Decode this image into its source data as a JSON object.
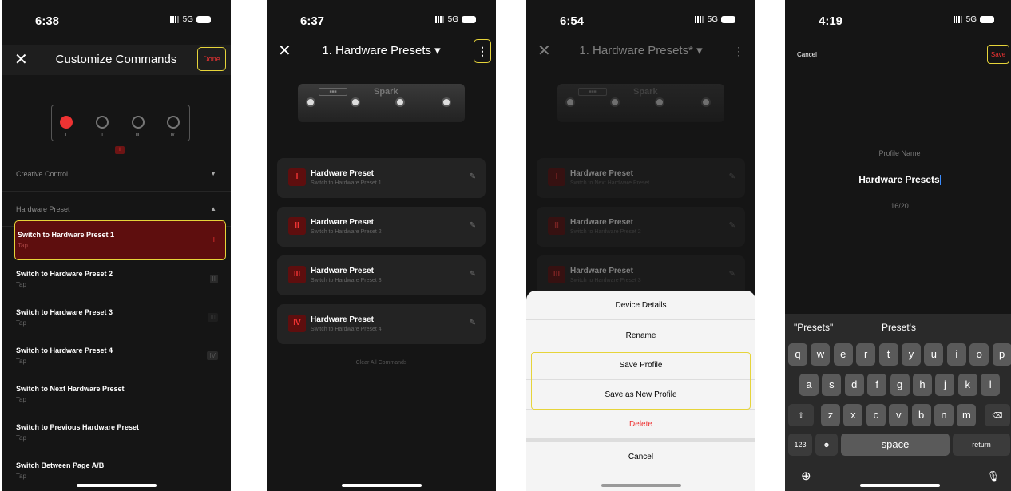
{
  "p1": {
    "time": "6:38",
    "net": "5G",
    "title": "Customize Commands",
    "done": "Done",
    "pedal_labels": [
      "I",
      "II",
      "III",
      "IV"
    ],
    "selected_badge": "I",
    "section_creative": "Creative Control",
    "section_hardware": "Hardware Preset",
    "rows": [
      {
        "title": "Switch to Hardware Preset 1",
        "sub": "Tap",
        "num": "I"
      },
      {
        "title": "Switch to Hardware Preset 2",
        "sub": "Tap",
        "num": "II"
      },
      {
        "title": "Switch to Hardware Preset 3",
        "sub": "Tap",
        "num": "III"
      },
      {
        "title": "Switch to Hardware Preset 4",
        "sub": "Tap",
        "num": "IV"
      },
      {
        "title": "Switch to Next Hardware Preset",
        "sub": "Tap"
      },
      {
        "title": "Switch to Previous Hardware Preset",
        "sub": "Tap"
      },
      {
        "title": "Switch Between Page A/B",
        "sub": "Tap"
      }
    ]
  },
  "p2": {
    "time": "6:37",
    "net": "5G",
    "title": "1. Hardware Presets ▾",
    "menu": "⋮",
    "device_logo": "Spark",
    "cards": [
      {
        "num": "I",
        "title": "Hardware Preset",
        "sub": "Switch to Hardware Preset 1"
      },
      {
        "num": "II",
        "title": "Hardware Preset",
        "sub": "Switch to Hardware Preset 2"
      },
      {
        "num": "III",
        "title": "Hardware Preset",
        "sub": "Switch to Hardware Preset 3"
      },
      {
        "num": "IV",
        "title": "Hardware Preset",
        "sub": "Switch to Hardware Preset 4"
      }
    ],
    "clear": "Clear All Commands"
  },
  "p3": {
    "time": "6:54",
    "net": "5G",
    "title": "1. Hardware Presets* ▾",
    "device_logo": "Spark",
    "cards": [
      {
        "num": "I",
        "title": "Hardware Preset",
        "sub": "Switch to Next Hardware Preset"
      },
      {
        "num": "II",
        "title": "Hardware Preset",
        "sub": "Switch to Hardware Preset 2"
      },
      {
        "num": "III",
        "title": "Hardware Preset",
        "sub": "Switch to Hardware Preset 3"
      }
    ],
    "sheet": {
      "device_details": "Device Details",
      "rename": "Rename",
      "save_profile": "Save Profile",
      "save_new": "Save as New Profile",
      "delete": "Delete",
      "cancel": "Cancel"
    }
  },
  "p4": {
    "time": "4:19",
    "net": "5G",
    "cancel": "Cancel",
    "save": "Save",
    "profile_label": "Profile Name",
    "profile_name": "Hardware Presets",
    "count": "16/20",
    "suggestions": [
      "\"Presets\"",
      "Preset's"
    ],
    "row1": [
      "q",
      "w",
      "e",
      "r",
      "t",
      "y",
      "u",
      "i",
      "o",
      "p"
    ],
    "row2": [
      "a",
      "s",
      "d",
      "f",
      "g",
      "h",
      "j",
      "k",
      "l"
    ],
    "row3": [
      "z",
      "x",
      "c",
      "v",
      "b",
      "n",
      "m"
    ],
    "num_key": "123",
    "space": "space",
    "return": "return"
  }
}
